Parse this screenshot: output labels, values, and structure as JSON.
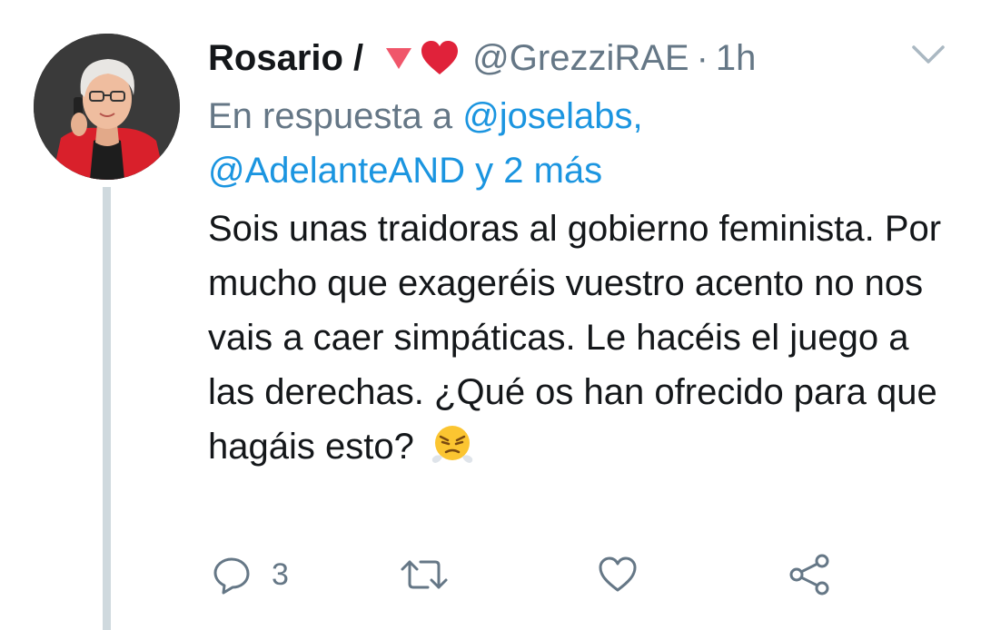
{
  "tweet": {
    "author_name": "Rosario /",
    "badges": [
      "red-triangle-down-icon",
      "red-heart-icon"
    ],
    "handle": "@GrezziRAE",
    "separator": "·",
    "time": "1h",
    "reply_prefix": "En respuesta a",
    "reply_mention_1": "@joselabs,",
    "reply_mention_2": "@AdelanteAND",
    "reply_more": "y 2 más",
    "body_text": "Sois unas traidoras al gobierno feminista. Por mucho que exageréis vuestro acento no nos vais a caer simpáticas. Le hacéis el juego a las derechas. ¿Qué os han ofrecido para que hagáis esto?",
    "body_emoji": "face-with-steam-from-nose-icon"
  },
  "actions": {
    "reply_count": "3",
    "retweet_count": "",
    "like_count": ""
  },
  "colors": {
    "link": "#1b95e0",
    "secondary_text": "#657786",
    "primary_text": "#14171a",
    "thread_line": "#cfd9de"
  }
}
